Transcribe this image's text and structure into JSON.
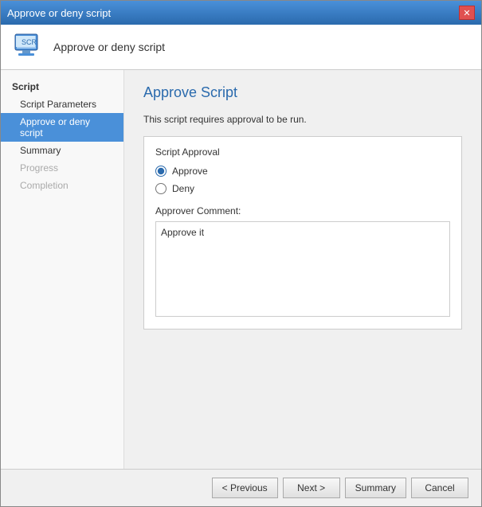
{
  "window": {
    "title": "Approve or deny script",
    "close_label": "✕"
  },
  "header": {
    "title": "Approve or deny script",
    "icon_alt": "script-icon"
  },
  "sidebar": {
    "section_label": "Script",
    "items": [
      {
        "id": "script-parameters",
        "label": "Script Parameters",
        "state": "normal"
      },
      {
        "id": "approve-or-deny",
        "label": "Approve or deny script",
        "state": "active"
      },
      {
        "id": "summary",
        "label": "Summary",
        "state": "normal"
      },
      {
        "id": "progress",
        "label": "Progress",
        "state": "disabled"
      },
      {
        "id": "completion",
        "label": "Completion",
        "state": "disabled"
      }
    ]
  },
  "main": {
    "title": "Approve Script",
    "description": "This script requires approval to be run.",
    "approval_group_label": "Script Approval",
    "approve_label": "Approve",
    "deny_label": "Deny",
    "comment_label": "Approver Comment:",
    "comment_value": "Approve it"
  },
  "footer": {
    "previous_label": "< Previous",
    "next_label": "Next >",
    "summary_label": "Summary",
    "cancel_label": "Cancel"
  }
}
